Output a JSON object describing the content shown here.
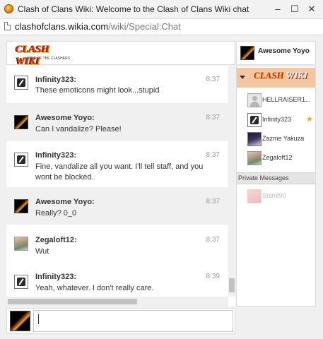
{
  "window": {
    "title": "Clash of Clans Wiki: Welcome to the Clash of Clans Wiki chat",
    "controls": {
      "minimize": "–",
      "maximize": "☐",
      "close": "✕"
    }
  },
  "address": {
    "host": "clashofclans.wikia.com",
    "path": "/wiki/Special:Chat"
  },
  "header": {
    "logo_text": "CLASH WIKI",
    "logo_subtitle": "HOME OF THE CLASHERS",
    "current_user": "Awesome Yoyo"
  },
  "messages": [
    {
      "author": "Infinity323:",
      "time": "8:37",
      "text": "These emoticons might look...stupid",
      "avatar": "infinity-icon"
    },
    {
      "author": "Awesome Yoyo:",
      "time": "8:37",
      "text": "Can I vandalize? Please!",
      "avatar": "yoyo-icon"
    },
    {
      "author": "Infinity323:",
      "time": "8:37",
      "text": "Fine, vandalize all you want. I'll tell staff, and you wont be blocked.",
      "avatar": "infinity-icon"
    },
    {
      "author": "Awesome Yoyo:",
      "time": "8:37",
      "text": "Really? 0_0",
      "avatar": "yoyo-icon"
    },
    {
      "author": "Zegaloft12:",
      "time": "8:37",
      "text": "Wut",
      "avatar": "zegaloft-icon"
    },
    {
      "author": "Infinity323:",
      "time": "8:39",
      "text": "Yeah, whatever. I don't really care.",
      "avatar": "infinity-icon"
    }
  ],
  "input": {
    "value": ""
  },
  "sidebar": {
    "room_logo": "CLASH",
    "room_logo_wiki": "WIKI",
    "users": [
      {
        "name": "HELLRAISER1...",
        "avatar": "default-avatar-icon"
      },
      {
        "name": "Infinity323",
        "avatar": "infinity-icon",
        "badge": "★"
      },
      {
        "name": "Zazme Yakuza",
        "avatar": "zazme-icon"
      },
      {
        "name": "Zegaloft12",
        "avatar": "zegaloft-icon"
      }
    ],
    "private_messages_label": "Private Messages",
    "private_messages": [
      {
        "name": "Stan890",
        "avatar": "stan-icon"
      }
    ]
  },
  "colors": {
    "room_highlight": "#f2c7a2",
    "alt_message_bg": "#f0f0f0",
    "star": "#f3a51b"
  }
}
